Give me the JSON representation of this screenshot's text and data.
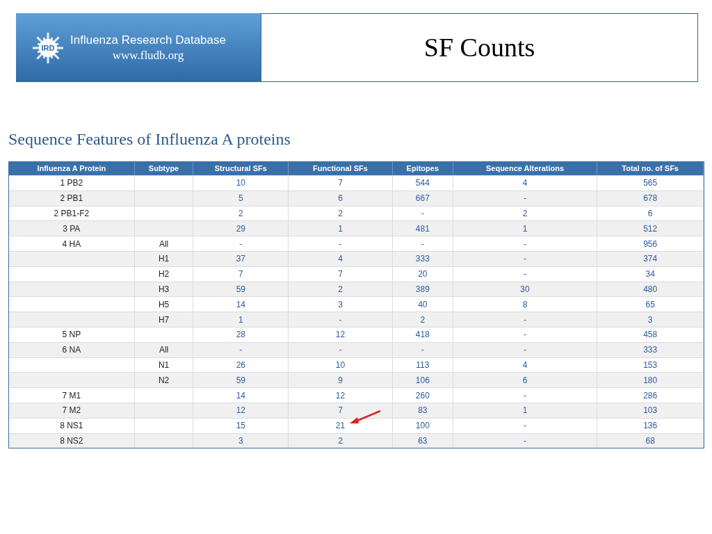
{
  "banner": {
    "name": "Influenza Research Database",
    "logo_text": "IRD",
    "url": "www.fludb.org"
  },
  "slide_title": "SF Counts",
  "section_title": "Sequence Features of Influenza A proteins",
  "table": {
    "columns": [
      "Influenza A Protein",
      "Subtype",
      "Structural SFs",
      "Functional SFs",
      "Epitopes",
      "Sequence Alterations",
      "Total no. of SFs"
    ],
    "rows": [
      {
        "cells": [
          "1 PB2",
          null,
          "10",
          "7",
          "544",
          "4",
          "565"
        ],
        "arrowed": false
      },
      {
        "cells": [
          "2 PB1",
          null,
          "5",
          "6",
          "667",
          "-",
          "678"
        ],
        "arrowed": false
      },
      {
        "cells": [
          "2 PB1-F2",
          null,
          "2",
          "2",
          "-",
          "2",
          "6"
        ],
        "arrowed": false
      },
      {
        "cells": [
          "3 PA",
          null,
          "29",
          "1",
          "481",
          "1",
          "512"
        ],
        "arrowed": false
      },
      {
        "cells": [
          "4 HA",
          "All",
          "-",
          "-",
          "-",
          "-",
          "956"
        ],
        "arrowed": false
      },
      {
        "cells": [
          null,
          "H1",
          "37",
          "4",
          "333",
          "-",
          "374"
        ],
        "arrowed": false
      },
      {
        "cells": [
          null,
          "H2",
          "7",
          "7",
          "20",
          "-",
          "34"
        ],
        "arrowed": false
      },
      {
        "cells": [
          null,
          "H3",
          "59",
          "2",
          "389",
          "30",
          "480"
        ],
        "arrowed": false
      },
      {
        "cells": [
          null,
          "H5",
          "14",
          "3",
          "40",
          "8",
          "65"
        ],
        "arrowed": false
      },
      {
        "cells": [
          null,
          "H7",
          "1",
          "-",
          "2",
          "-",
          "3"
        ],
        "arrowed": false
      },
      {
        "cells": [
          "5 NP",
          null,
          "28",
          "12",
          "418",
          "-",
          "458"
        ],
        "arrowed": false
      },
      {
        "cells": [
          "6 NA",
          "All",
          "-",
          "-",
          "-",
          "-",
          "333"
        ],
        "arrowed": false
      },
      {
        "cells": [
          null,
          "N1",
          "26",
          "10",
          "113",
          "4",
          "153"
        ],
        "arrowed": false
      },
      {
        "cells": [
          null,
          "N2",
          "59",
          "9",
          "106",
          "6",
          "180"
        ],
        "arrowed": false
      },
      {
        "cells": [
          "7 M1",
          null,
          "14",
          "12",
          "260",
          "-",
          "286"
        ],
        "arrowed": false
      },
      {
        "cells": [
          "7 M2",
          null,
          "12",
          "7",
          "83",
          "1",
          "103"
        ],
        "arrowed": false
      },
      {
        "cells": [
          "8 NS1",
          null,
          "15",
          "21",
          "100",
          "-",
          "136"
        ],
        "arrowed": true
      },
      {
        "cells": [
          "8 NS2",
          null,
          "3",
          "2",
          "63",
          "-",
          "68"
        ],
        "arrowed": false
      }
    ]
  }
}
